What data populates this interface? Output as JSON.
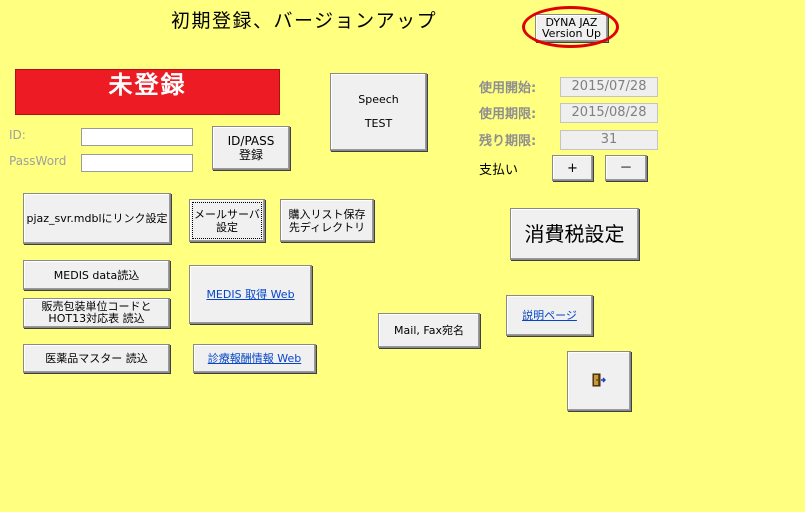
{
  "title": "初期登録、バージョンアップ",
  "version_up_button": {
    "line1": "DYNA JAZ",
    "line2": "Version Up"
  },
  "status_banner": "未登録",
  "speech_button": {
    "line1": "Speech",
    "line2": "TEST"
  },
  "login": {
    "id_label": "ID:",
    "id_value": "",
    "password_label": "PassWord",
    "password_value": "",
    "register_button": {
      "line1": "ID/PASS",
      "line2": "登録"
    }
  },
  "license": {
    "start_label": "使用開始:",
    "start_value": "2015/07/28",
    "expiry_label": "使用期限:",
    "expiry_value": "2015/08/28",
    "remaining_label": "残り期限:",
    "remaining_value": "31",
    "payment_label": "支払い",
    "plus_label": "+",
    "minus_label": "－"
  },
  "buttons": {
    "link_settings": "pjaz_svr.mdblにリンク設定",
    "mail_server": {
      "line1": "メールサーバ",
      "line2": "設定"
    },
    "purchase_list": {
      "line1": "購入リスト保存",
      "line2": "先ディレクトリ"
    },
    "consumption_tax": "消費税設定",
    "medis_data": "MEDIS data読込",
    "sales_code": {
      "line1": "販売包装単位コードと",
      "line2": "HOT13対応表 読込"
    },
    "medis_web": "MEDIS 取得 Web",
    "manual_page": "説明ページ",
    "mail_fax": "Mail, Fax宛名",
    "drug_master": "医薬品マスター 読込",
    "fee_info_web": "診療報酬情報 Web"
  },
  "colors": {
    "background": "#FFFF80",
    "banner": "#ED1C24",
    "highlight_circle": "#E00000",
    "link": "#0645C8"
  },
  "icons": {
    "exit": "exit-door-icon"
  }
}
